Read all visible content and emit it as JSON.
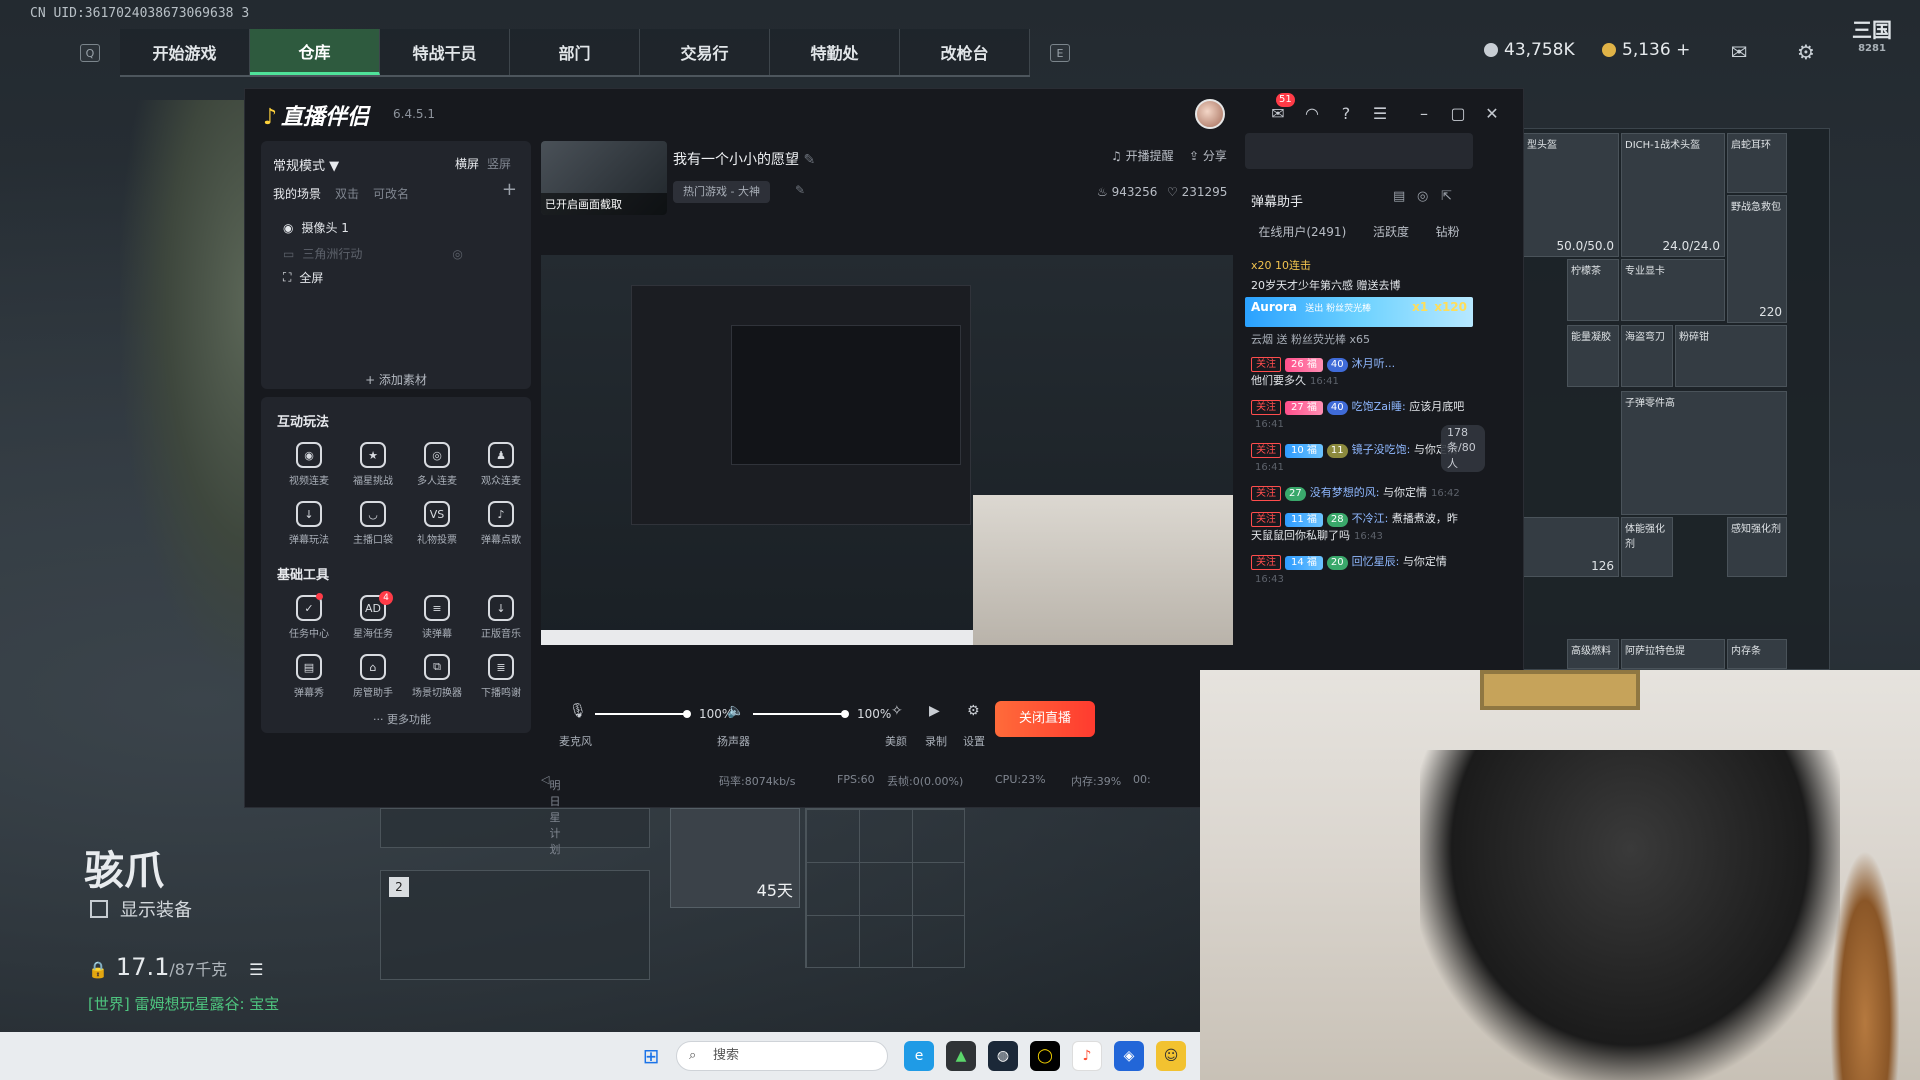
{
  "game": {
    "uid_text": "CN UID:3617024038673069638 3",
    "nav_keys": {
      "left": "Q",
      "right": "E"
    },
    "nav_tabs": [
      "开始游戏",
      "仓库",
      "特战干员",
      "部门",
      "交易行",
      "特勤处",
      "改枪台"
    ],
    "active_tab": "仓库",
    "currency_1": "43,758K",
    "currency_2": "5,136 +",
    "logo_text": "三国",
    "logo_sub": "8281",
    "character_name": "骇爪",
    "show_equipment": "显示装备",
    "weight_value": "17.1",
    "weight_capacity": "/87千克",
    "world_chat": "[世界] 雷姆想玩星露谷: 宝宝",
    "slot_number": "2",
    "battery_days": "45天",
    "inventory": [
      {
        "label": "型头盔",
        "cap": "50.0/50.0"
      },
      {
        "label": "DICH-1战术头盔",
        "cap": "24.0/24.0"
      },
      {
        "label": "启蛇耳环",
        "cap": ""
      },
      {
        "label": "野战急救包",
        "cap": "220"
      },
      {
        "label": "柠檬茶",
        "cap": ""
      },
      {
        "label": "专业显卡",
        "cap": ""
      },
      {
        "label": "能量凝胶",
        "cap": ""
      },
      {
        "label": "海盗弯刀",
        "cap": ""
      },
      {
        "label": "粉碎钳",
        "cap": ""
      },
      {
        "label": "子弹零件高",
        "cap": ""
      },
      {
        "label": "体能强化剂",
        "cap": ""
      },
      {
        "label": "感知强化剂",
        "cap": ""
      },
      {
        "label": "高级燃料",
        "cap": ""
      },
      {
        "label": "阿萨拉特色提",
        "cap": ""
      },
      {
        "label": "内存条",
        "cap": ""
      }
    ],
    "inv_count": "126"
  },
  "app": {
    "name": "直播伴侣",
    "version": "6.4.5.1",
    "msg_count": "51",
    "mode": "常规模式 ▼",
    "orient_h": "横屏",
    "orient_v": "竖屏",
    "scene_tabs": [
      "我的场景",
      "双击",
      "可改名"
    ],
    "scenes": [
      {
        "label": "摄像头 1",
        "dim": false
      },
      {
        "label": "三角洲行动",
        "dim": true
      },
      {
        "label": "全屏",
        "dim": false
      }
    ],
    "add_material": "+ 添加素材",
    "interactive_title": "互动玩法",
    "interactive_tools": [
      "视频连麦",
      "福星挑战",
      "多人连麦",
      "观众连麦",
      "弹幕玩法",
      "主播口袋",
      "礼物投票",
      "弹幕点歌"
    ],
    "basic_title": "基础工具",
    "basic_tools": [
      "任务中心",
      "星海任务",
      "读弹幕",
      "正版音乐",
      "弹幕秀",
      "房管助手",
      "场景切换器",
      "下播鸣谢"
    ],
    "basic_badge": "4",
    "more_functions": "··· 更多功能",
    "thumb_caption": "已开启画面截取",
    "stream_title": "我有一个小小的愿望",
    "category": "热门游戏 - 大神",
    "remind": "开播提醒",
    "share": "分享",
    "heat": "943256",
    "likes": "231295",
    "mic_label": "麦克风",
    "mic_pct": "100%",
    "speaker_label": "扬声器",
    "speaker_pct": "100%",
    "beauty": "美颜",
    "record": "录制",
    "settings": "设置",
    "end_live": "关闭直播",
    "status": {
      "plan": "明日星计划",
      "bitrate": "码率:8074kb/s",
      "fps": "FPS:60",
      "drop": "丢帧:0(0.00%)",
      "cpu": "CPU:23%",
      "mem": "内存:39%",
      "time": "00:"
    }
  },
  "danmu": {
    "title": "弹幕助手",
    "tabs": [
      "在线用户(2491)",
      "活跃度",
      "钻粉"
    ],
    "combo": "x20 10连击",
    "gift_line": "20岁天才少年第六感 赠送去博",
    "aurora_name": "Aurora",
    "aurora_tag": "送出 粉丝荧光棒",
    "aurora_mult": "x1",
    "aurora_count": "x120",
    "gift_sub": "云烟 送 粉丝荧光棒 x65",
    "online_badge": "178条/80人",
    "messages": [
      {
        "fan": "26",
        "lvl": "40",
        "name": "沐月听...",
        "text": "他们要多久",
        "ts": "16:41"
      },
      {
        "fan": "27",
        "lvl": "40",
        "name": "吃饱Zai睡:",
        "text": "应该月底吧",
        "ts": "16:41"
      },
      {
        "fan": "10",
        "lvl": "11",
        "name": "镜子没吃饱:",
        "text": "与你定情",
        "ts": "16:41"
      },
      {
        "fan": "",
        "lvl": "27",
        "name": "没有梦想的风:",
        "text": "与你定情",
        "ts": "16:42"
      },
      {
        "fan": "11",
        "lvl": "28",
        "name": "不冷江:",
        "text": "煮播煮波，昨天鼠鼠回你私聊了吗",
        "ts": "16:43"
      },
      {
        "fan": "14",
        "lvl": "20",
        "name": "回忆星辰:",
        "text": "与你定情",
        "ts": "16:43"
      }
    ],
    "follow_label": "关注",
    "fan_club": "福"
  },
  "taskbar": {
    "search_placeholder": "搜索"
  },
  "colors": {
    "accent_green": "#4fe39a",
    "end_live": "#ff3b2f",
    "badge_red": "#ff3b47"
  }
}
